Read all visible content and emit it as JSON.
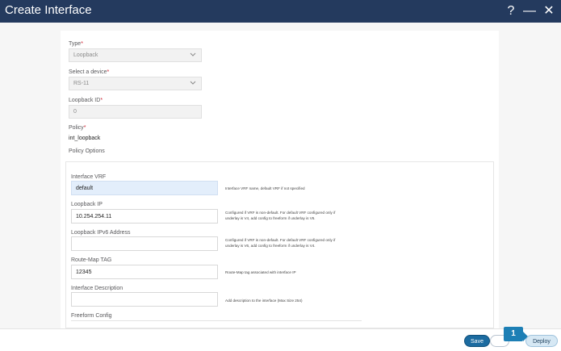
{
  "window": {
    "title": "Create Interface",
    "help_icon": "?",
    "minimize_icon": "—",
    "close_icon": "✕"
  },
  "form": {
    "type": {
      "label": "Type",
      "value": "Loopback"
    },
    "device": {
      "label": "Select a device",
      "value": "RS-11"
    },
    "loopback_id": {
      "label": "Loopback ID",
      "value": "0"
    },
    "policy": {
      "label": "Policy",
      "value": "int_loopback"
    },
    "policy_options_label": "Policy Options",
    "required_mark": "*"
  },
  "policy_options": {
    "interface_vrf": {
      "label": "Interface VRF",
      "value": "default",
      "help": "Interface VRF name, default VRF if not specified"
    },
    "loopback_ip": {
      "label": "Loopback IP",
      "value": "10.254.254.11",
      "help": "Configured if VRF is non-default. For default VRF configured only if underlay is V4, add config to freeform if underlay is V6."
    },
    "loopback_ipv6": {
      "label": "Loopback IPv6 Address",
      "value": "",
      "help": "Configured if VRF is non-default. For default VRF configured only if underlay is V6, add config to freeform if underlay is V4."
    },
    "route_map_tag": {
      "label": "Route-Map TAG",
      "value": "12345",
      "help": "Route-Map tag associated with interface IP"
    },
    "interface_description": {
      "label": "Interface Description",
      "value": "",
      "help": "Add description to the interface (Max Size 254)"
    },
    "freeform_config": {
      "label": "Freeform Config"
    }
  },
  "footer": {
    "save_label": "Save",
    "badge": "1",
    "deploy_label": "Deploy"
  },
  "colors": {
    "header": "#243a5e",
    "required": "#cf2030",
    "save": "#1c6ba0",
    "badge": "#1d7fb5"
  }
}
